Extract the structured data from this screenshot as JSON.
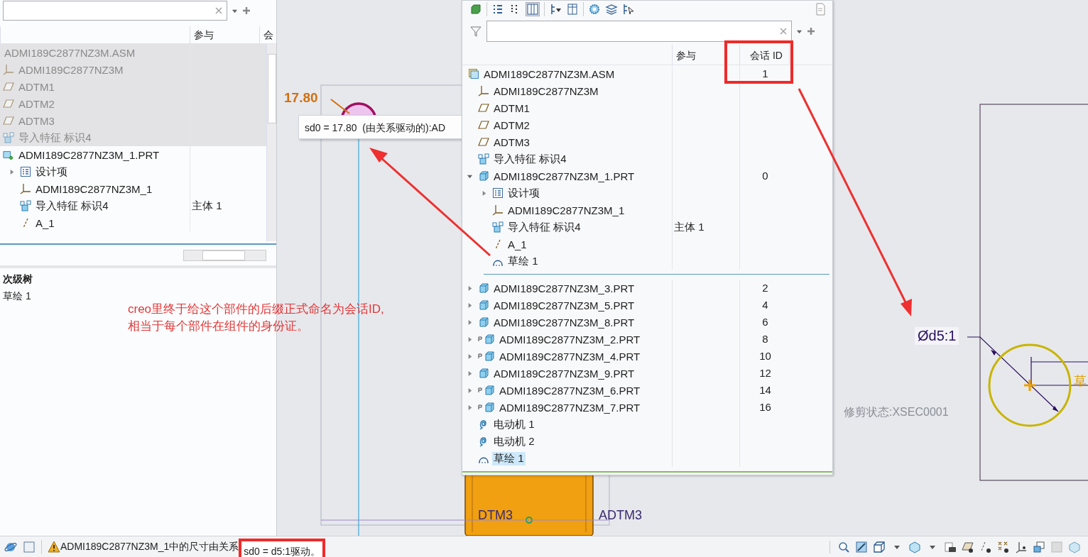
{
  "left_panel": {
    "columns": [
      "参与",
      "会"
    ],
    "tree": [
      {
        "label": "ADMI189C2877NZ3M.ASM",
        "kind": "text",
        "highlighted": true
      },
      {
        "label": "ADMI189C2877NZ3M",
        "kind": "csys",
        "highlighted": true
      },
      {
        "label": "ADTM1",
        "kind": "plane",
        "highlighted": true
      },
      {
        "label": "ADTM2",
        "kind": "plane",
        "highlighted": true
      },
      {
        "label": "ADTM3",
        "kind": "plane",
        "highlighted": true
      },
      {
        "label": "导入特征 标识4",
        "kind": "import",
        "highlighted": true
      },
      {
        "label": "ADMI189C2877NZ3M_1.PRT",
        "kind": "active_part",
        "highlighted": false,
        "children": [
          {
            "label": "设计项",
            "kind": "design",
            "highlighted": false,
            "expanded": false
          },
          {
            "label": "ADMI189C2877NZ3M_1",
            "kind": "csys",
            "highlighted": false
          },
          {
            "label": "导入特征 标识4",
            "kind": "import",
            "highlighted": false,
            "participation": "主体 1"
          },
          {
            "label": "A_1",
            "kind": "axis",
            "highlighted": false
          }
        ]
      }
    ],
    "secondary_tree": {
      "title": "次级树",
      "items": [
        "草绘 1"
      ]
    }
  },
  "model_tree": {
    "columns": [
      "参与",
      "会话 ID"
    ],
    "items": [
      {
        "label": "ADMI189C2877NZ3M.ASM",
        "kind": "asm",
        "selected": false,
        "session_id": "1",
        "children": [
          {
            "label": "ADMI189C2877NZ3M",
            "kind": "csys",
            "selected": false
          },
          {
            "label": "ADTM1",
            "kind": "plane",
            "selected": false
          },
          {
            "label": "ADTM2",
            "kind": "plane",
            "selected": false
          },
          {
            "label": "ADTM3",
            "kind": "plane",
            "selected": false
          },
          {
            "label": "导入特征 标识4",
            "kind": "import",
            "selected": false
          },
          {
            "label": "ADMI189C2877NZ3M_1.PRT",
            "kind": "part",
            "selected": false,
            "expanded": true,
            "session_id": "0",
            "children": [
              {
                "label": "设计项",
                "kind": "design",
                "selected": false,
                "expanded": false
              },
              {
                "label": "ADMI189C2877NZ3M_1",
                "kind": "csys",
                "selected": false
              },
              {
                "label": "导入特征 标识4",
                "kind": "import",
                "selected": false,
                "participation": "主体 1"
              },
              {
                "label": "A_1",
                "kind": "axis",
                "selected": false
              },
              {
                "label": "草绘 1",
                "kind": "sketch",
                "selected": false
              }
            ]
          },
          {
            "label": "ADMI189C2877NZ3M_3.PRT",
            "kind": "part",
            "selected": false,
            "expanded": false,
            "marked": false,
            "session_id": "2"
          },
          {
            "label": "ADMI189C2877NZ3M_5.PRT",
            "kind": "part",
            "selected": false,
            "expanded": false,
            "marked": false,
            "session_id": "4"
          },
          {
            "label": "ADMI189C2877NZ3M_8.PRT",
            "kind": "part",
            "selected": false,
            "expanded": false,
            "marked": false,
            "session_id": "6"
          },
          {
            "label": "ADMI189C2877NZ3M_2.PRT",
            "kind": "part",
            "selected": false,
            "expanded": false,
            "marked": true,
            "session_id": "8"
          },
          {
            "label": "ADMI189C2877NZ3M_4.PRT",
            "kind": "part",
            "selected": false,
            "expanded": false,
            "marked": true,
            "session_id": "10"
          },
          {
            "label": "ADMI189C2877NZ3M_9.PRT",
            "kind": "part",
            "selected": false,
            "expanded": false,
            "marked": false,
            "session_id": "12"
          },
          {
            "label": "ADMI189C2877NZ3M_6.PRT",
            "kind": "part",
            "selected": false,
            "expanded": false,
            "marked": true,
            "session_id": "14"
          },
          {
            "label": "ADMI189C2877NZ3M_7.PRT",
            "kind": "part",
            "selected": false,
            "expanded": false,
            "marked": true,
            "session_id": "16"
          },
          {
            "label": "电动机 1",
            "kind": "motor",
            "selected": false
          },
          {
            "label": "电动机 2",
            "kind": "motor",
            "selected": false
          },
          {
            "label": "草绘 1",
            "kind": "sketch",
            "selected": true
          }
        ]
      }
    ]
  },
  "canvas": {
    "dimension": "17.80",
    "tooltip": "sd0 = 17.80  (由关系驱动的):AD",
    "diameter_label": "Ød5:1",
    "clip_status": "修剪状态:XSEC0001",
    "partial_label": "草",
    "datum_labels": [
      "DTM3",
      "ADTM3"
    ]
  },
  "annotation": {
    "lines": [
      "creo里终于给这个部件的后缀正式命名为会话ID,",
      "相当于每个部件在组件的身份证。"
    ]
  },
  "status_bar": {
    "message": "ADMI189C2877NZ3M_1中的尺寸由关系",
    "highlighted_message": "sd0 = d5:1驱动。"
  }
}
